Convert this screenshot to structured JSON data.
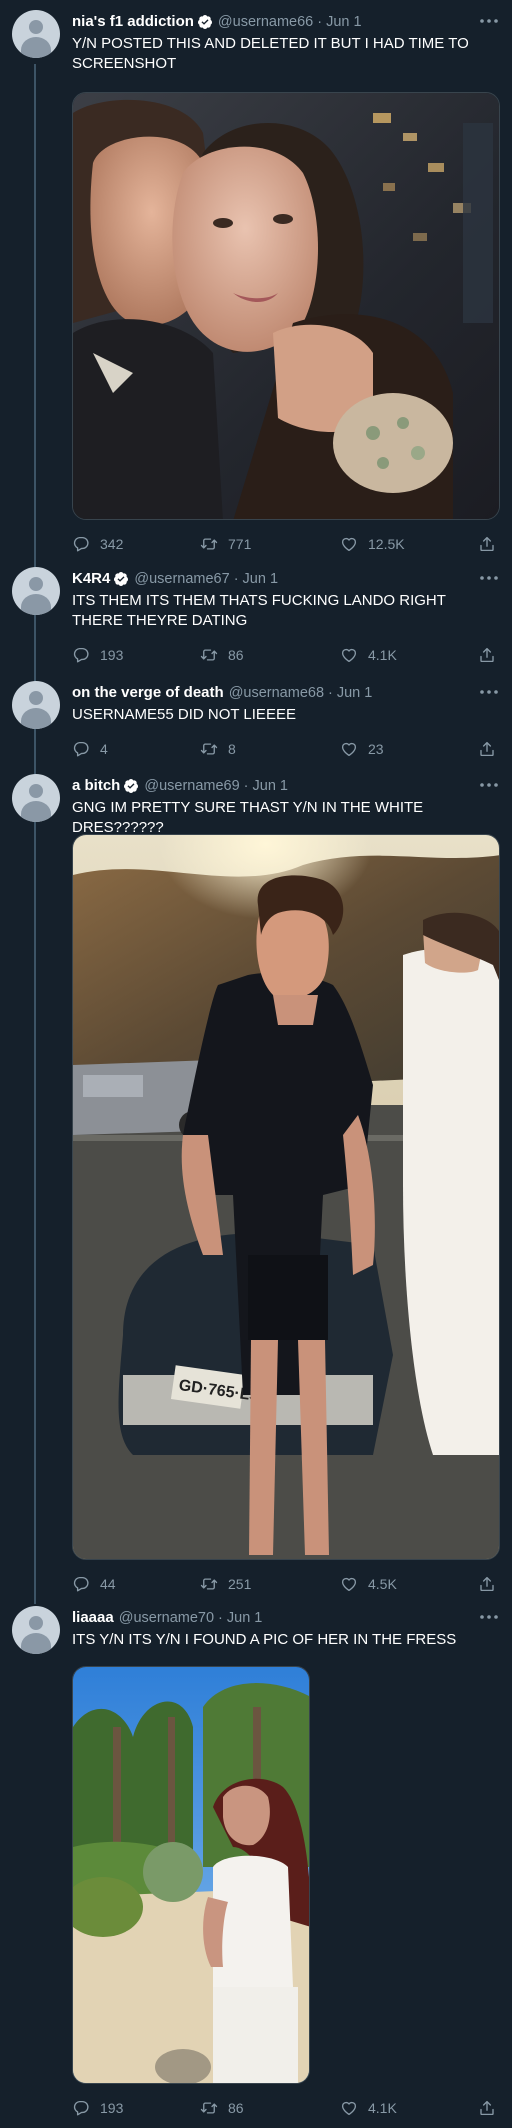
{
  "tweets": [
    {
      "display_name": "nia's f1 addiction",
      "verified": true,
      "handle": "@username66",
      "date": "Jun 1",
      "text": "Y/N POSTED THIS AND DELETED IT BUT I HAD TIME TO SCREENSHOT",
      "media": "photo: couple selfie at night, city lights",
      "replies": "342",
      "retweets": "771",
      "likes": "12.5K"
    },
    {
      "display_name": "K4R4",
      "verified": true,
      "handle": "@username67",
      "date": "Jun 1",
      "text": "ITS THEM ITS THEM THATS FUCKING LANDO RIGHT THERE THEYRE DATING",
      "replies": "193",
      "retweets": "86",
      "likes": "4.1K"
    },
    {
      "display_name": "on the verge of death",
      "verified": false,
      "handle": "@username68",
      "date": "Jun 1",
      "text": "USERNAME55 DID NOT LIEEEE",
      "replies": "4",
      "retweets": "8",
      "likes": "23"
    },
    {
      "display_name": "a bitch",
      "verified": true,
      "handle": "@username69",
      "date": "Jun 1",
      "text": "GNG IM PRETTY SURE THAST Y/N IN THE WHITE DRES??????",
      "media": "photo: man in black outfit beside car at sunset",
      "replies": "44",
      "retweets": "251",
      "likes": "4.5K"
    },
    {
      "display_name": "liaaaa",
      "verified": false,
      "handle": "@username70",
      "date": "Jun 1",
      "text": "ITS Y/N ITS Y/N I FOUND A PIC OF HER IN THE FRESS",
      "media": "photo: woman in white top among palm trees",
      "replies": "193",
      "retweets": "86",
      "likes": "4.1K"
    }
  ],
  "colors": {
    "background": "#15202b",
    "secondary_text": "#8899a6",
    "thread_line": "#3d5466"
  },
  "icons": [
    "verified-badge-icon",
    "more-icon",
    "reply-icon",
    "retweet-icon",
    "like-icon",
    "share-icon"
  ]
}
